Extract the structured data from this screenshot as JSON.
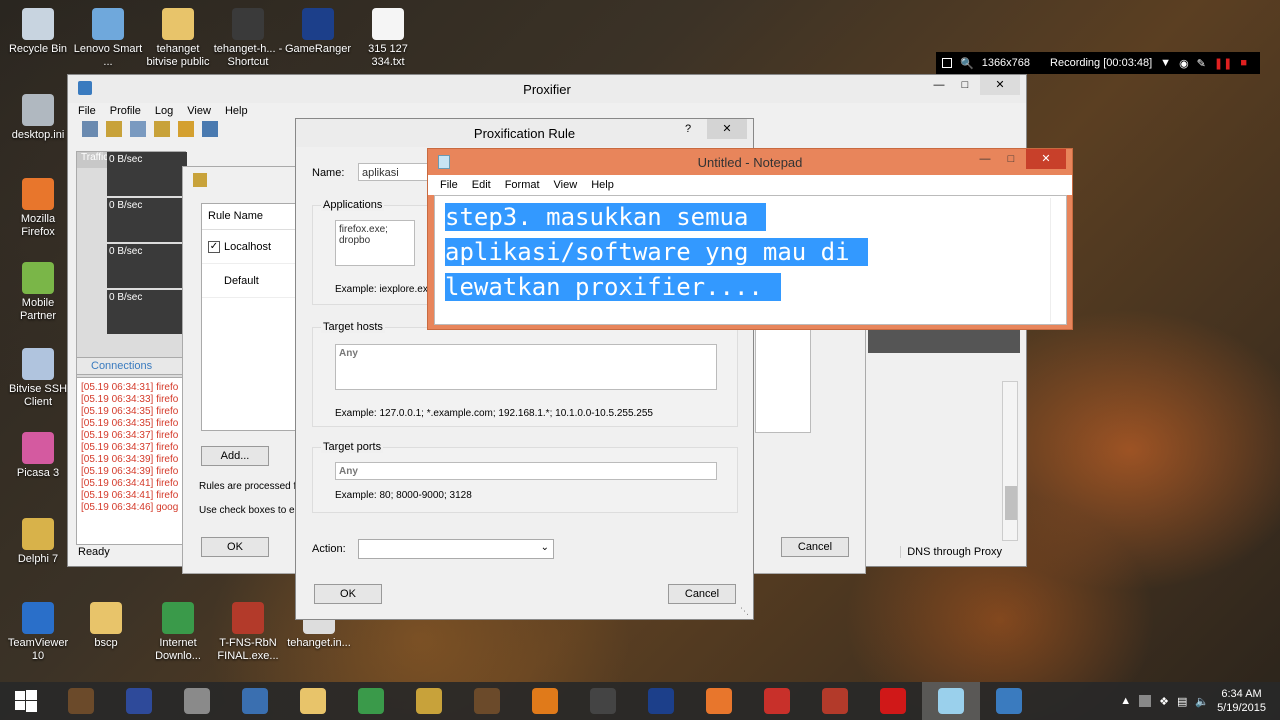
{
  "desktop_icons": [
    {
      "label": "Recycle Bin",
      "color": "#c8d4e0"
    },
    {
      "label": "Lenovo Smart ...",
      "color": "#6fa8dc"
    },
    {
      "label": "tehanget bitvise public",
      "color": "#e8c46a"
    },
    {
      "label": "tehanget-h... - Shortcut",
      "color": "#3a3a3a"
    },
    {
      "label": "GameRanger",
      "color": "#1c3f8a"
    },
    {
      "label": "315 127 334.txt",
      "color": "#f5f5f5"
    },
    {
      "label": "desktop.ini",
      "color": "#b0b8c0"
    },
    {
      "label": "Mozilla Firefox",
      "color": "#e8762c"
    },
    {
      "label": "Mobile Partner",
      "color": "#7ab648"
    },
    {
      "label": "Bitvise SSH Client",
      "color": "#b0c4de"
    },
    {
      "label": "Picasa 3",
      "color": "#d45aa0"
    },
    {
      "label": "Delphi 7",
      "color": "#d8b24a"
    },
    {
      "label": "TeamViewer 10",
      "color": "#2a6fc9"
    },
    {
      "label": "bscp",
      "color": "#e8c46a"
    },
    {
      "label": "Internet Downlo...",
      "color": "#3a9a4a"
    },
    {
      "label": "T-FNS-RbN FINAL.exe...",
      "color": "#b33a2a"
    },
    {
      "label": "tehanget.in...",
      "color": "#dddddd"
    }
  ],
  "recording": {
    "resolution": "1366x768",
    "status": "Recording [00:03:48]"
  },
  "proxifier": {
    "title": "Proxifier",
    "menu": [
      "File",
      "Profile",
      "Log",
      "View",
      "Help"
    ],
    "traffic_label": "Traffic",
    "rates": [
      "0 B/sec",
      "0 B/sec",
      "0 B/sec",
      "0 B/sec"
    ],
    "connections_tab": "Connections",
    "log": [
      "[05.19 06:34:31] firefo",
      "[05.19 06:34:33] firefo",
      "[05.19 06:34:35] firefo",
      "[05.19 06:34:35] firefo",
      "[05.19 06:34:37] firefo",
      "[05.19 06:34:37] firefo",
      "[05.19 06:34:39] firefo",
      "[05.19 06:34:39] firefo",
      "[05.19 06:34:41] firefo",
      "[05.19 06:34:41] firefo",
      "[05.19 06:34:46] goog"
    ],
    "status_ready": "Ready",
    "status_dns": "DNS through Proxy"
  },
  "rules_window": {
    "col_rule_name": "Rule Name",
    "rules": [
      {
        "name": "Localhost",
        "checked": true
      },
      {
        "name": "Default",
        "checked": false
      }
    ],
    "add_button": "Add...",
    "note1": "Rules are processed f",
    "note2": "Use check boxes to e",
    "ok_button": "OK",
    "cancel_button": "Cancel"
  },
  "rule_dialog": {
    "title": "Proxification Rule",
    "help": "?",
    "name_label": "Name:",
    "name_value": "aplikasi",
    "applications_label": "Applications",
    "applications_value": "firefox.exe; dropbo",
    "applications_example": "Example: iexplore.ex",
    "target_hosts_label": "Target hosts",
    "target_hosts_value": "Any",
    "target_hosts_example": "Example: 127.0.0.1; *.example.com; 192.168.1.*; 10.1.0.0-10.5.255.255",
    "target_ports_label": "Target ports",
    "target_ports_value": "Any",
    "target_ports_example": "Example: 80; 8000-9000; 3128",
    "action_label": "Action:",
    "ok_button": "OK",
    "cancel_button": "Cancel"
  },
  "notepad": {
    "title": "Untitled - Notepad",
    "menu": [
      "File",
      "Edit",
      "Format",
      "View",
      "Help"
    ],
    "lines": [
      "step3. masukkan semua",
      "aplikasi/software yng mau di",
      "lewatkan proxifier...."
    ]
  },
  "taskbar": {
    "items": [
      {
        "name": "tehanget-app",
        "color": "#6b4a2a",
        "active": false
      },
      {
        "name": "metro-m",
        "color": "#2e4a9a",
        "active": false
      },
      {
        "name": "file-tool",
        "color": "#8a8a8a",
        "active": false
      },
      {
        "name": "network-app",
        "color": "#3a6fb0",
        "active": false
      },
      {
        "name": "explorer",
        "color": "#e8c46a",
        "active": false
      },
      {
        "name": "idm",
        "color": "#3a9a4a",
        "active": false
      },
      {
        "name": "tehanget-2",
        "color": "#c8a23a",
        "active": false
      },
      {
        "name": "tehanget-3",
        "color": "#6b4a2a",
        "active": false
      },
      {
        "name": "vpn-app",
        "color": "#e07a1a",
        "active": false
      },
      {
        "name": "media-321",
        "color": "#444444",
        "active": false
      },
      {
        "name": "gameranger",
        "color": "#1c3f8a",
        "active": false
      },
      {
        "name": "firefox",
        "color": "#e8762c",
        "active": false
      },
      {
        "name": "cs-app",
        "color": "#c8302a",
        "active": false
      },
      {
        "name": "fns-app",
        "color": "#b33a2a",
        "active": false
      },
      {
        "name": "recorder",
        "color": "#d01818",
        "active": false
      },
      {
        "name": "notepad",
        "color": "#9ad0ec",
        "active": true
      },
      {
        "name": "proxifier",
        "color": "#3a7bbf",
        "active": false
      }
    ],
    "time": "6:34 AM",
    "date": "5/19/2015"
  }
}
